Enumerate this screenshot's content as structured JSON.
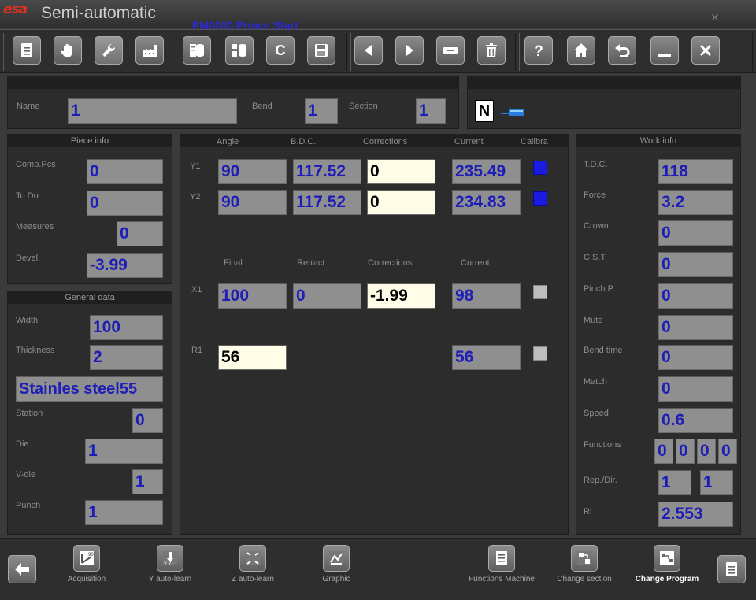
{
  "titlebar": {
    "logo": "esa",
    "app_title": "Semi-automatic",
    "program_name": "PM0000 Prince Start",
    "win_mark": "✕"
  },
  "toolbar": {
    "buttons": [
      {
        "name": "new-document-button",
        "icon": "document-icon"
      },
      {
        "name": "manual-hand-button",
        "icon": "hand-icon"
      },
      {
        "name": "tools-button",
        "icon": "wrench-icon",
        "selected": true
      },
      {
        "name": "machine-button",
        "icon": "factory-icon"
      },
      {
        "name": "database-button",
        "icon": "database-icon"
      },
      {
        "name": "list-database-button",
        "icon": "list-database-icon"
      },
      {
        "name": "c-button",
        "icon": "letter-c-icon"
      },
      {
        "name": "save-button",
        "icon": "save-icon"
      },
      {
        "name": "previous-button",
        "icon": "arrow-left-icon"
      },
      {
        "name": "next-button",
        "icon": "arrow-right-icon"
      },
      {
        "name": "remove-button",
        "icon": "minus-bar-icon"
      },
      {
        "name": "delete-button",
        "icon": "trash-icon"
      },
      {
        "name": "help-button",
        "icon": "question-icon"
      },
      {
        "name": "home-button",
        "icon": "home-icon"
      },
      {
        "name": "undo-button",
        "icon": "undo-icon"
      },
      {
        "name": "minimize-button",
        "icon": "minimize-icon"
      },
      {
        "name": "close-button",
        "icon": "close-icon"
      }
    ]
  },
  "header": {
    "name_label": "Name",
    "name_value": "1",
    "bend_label": "Bend",
    "bend_value": "1",
    "section_label": "Section",
    "section_value": "1",
    "n_indicator": "N"
  },
  "piece_info": {
    "title": "Piece info",
    "comp_pcs_label": "Comp.Pcs",
    "comp_pcs": "0",
    "to_do_label": "To Do",
    "to_do": "0",
    "measures_label": "Measures",
    "measures": "0",
    "devel_label": "Devel.",
    "devel": "-3.99"
  },
  "general_data": {
    "title": "General data",
    "width_label": "Width",
    "width": "100",
    "thickness_label": "Thickness",
    "thickness": "2",
    "material": "Stainles steel55",
    "station_label": "Station",
    "station": "0",
    "die_label": "Die",
    "die": "1",
    "vdie_label": "V-die",
    "vdie": "1",
    "punch_label": "Punch",
    "punch": "1"
  },
  "axes": {
    "col_angle": "Angle",
    "col_bdc": "B.D.C.",
    "col_corrections": "Corrections",
    "col_current": "Current",
    "col_calibra": "Calibra",
    "y1_label": "Y1",
    "y1_angle": "90",
    "y1_bdc": "117.52",
    "y1_corr": "0",
    "y1_current": "235.49",
    "y2_label": "Y2",
    "y2_angle": "90",
    "y2_bdc": "117.52",
    "y2_corr": "0",
    "y2_current": "234.83",
    "col_final": "Final",
    "col_retract": "Retract",
    "col_corrections2": "Corrections",
    "col_current2": "Current",
    "x1_label": "X1",
    "x1_final": "100",
    "x1_retract": "0",
    "x1_corr": "-1.99",
    "x1_current": "98",
    "r1_label": "R1",
    "r1_final": "56",
    "r1_current": "56"
  },
  "work_info": {
    "title": "Work info",
    "tdc_label": "T.D.C.",
    "tdc": "118",
    "force_label": "Force",
    "force": "3.2",
    "crown_label": "Crown",
    "crown": "0",
    "cst_label": "C.S.T.",
    "cst": "0",
    "pinch_label": "Pinch P.",
    "pinch": "0",
    "mute_label": "Mute",
    "mute": "0",
    "bend_time_label": "Bend time",
    "bend_time": "0",
    "match_label": "Match",
    "match": "0",
    "speed_label": "Speed",
    "speed": "0.6",
    "functions_label": "Functions",
    "functions": [
      "0",
      "0",
      "0",
      "0"
    ],
    "rep_label": "Rep./Dir.",
    "rep": "1",
    "dir": "1",
    "ri_label": "Ri",
    "ri": "2.553"
  },
  "bottombar": {
    "acquisition": "Acquisition",
    "y_auto_learn": "Y auto-learn",
    "z_auto_learn": "Z auto-learn",
    "graphic": "Graphic",
    "functions_machine": "Functions Machine",
    "change_section": "Change section",
    "change_program": "Change Program"
  }
}
